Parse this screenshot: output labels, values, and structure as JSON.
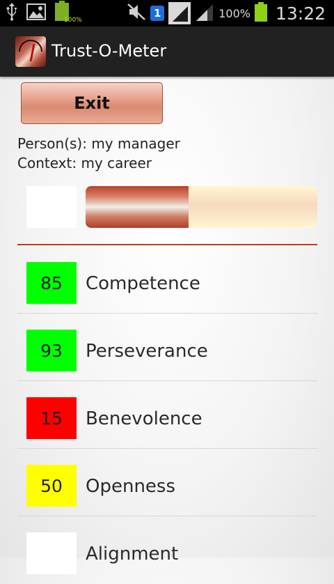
{
  "statusbar": {
    "notif_battery_pct": "100%",
    "sim_badge": "1",
    "battery_pct": "100%",
    "time": "13:22"
  },
  "app": {
    "title": "Trust-O-Meter"
  },
  "exit": {
    "label": "Exit"
  },
  "info": {
    "person_line": "Person(s): my manager",
    "context_line": "Context: my career"
  },
  "meter": {
    "fill_percent": 44.5,
    "overall_score": ""
  },
  "colors": {
    "green": "#00ff00",
    "red": "#ff0000",
    "yellow": "#ffff00",
    "white": "#ffffff",
    "accent_red": "#c0391e"
  },
  "factors": [
    {
      "score": "85",
      "label": "Competence",
      "color": "#00ff00"
    },
    {
      "score": "93",
      "label": "Perseverance",
      "color": "#00ff00"
    },
    {
      "score": "15",
      "label": "Benevolence",
      "color": "#ff0000"
    },
    {
      "score": "50",
      "label": "Openness",
      "color": "#ffff00"
    },
    {
      "score": "",
      "label": "Alignment",
      "color": "#ffffff"
    }
  ]
}
